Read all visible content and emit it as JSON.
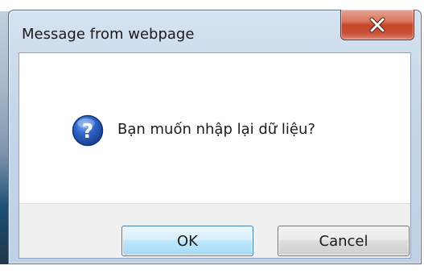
{
  "dialog": {
    "title": "Message from webpage",
    "message": "Bạn muốn nhập lại dữ liệu?",
    "icon": "question-icon",
    "close_icon": "close-icon",
    "buttons": {
      "ok_label": "OK",
      "cancel_label": "Cancel"
    }
  },
  "colors": {
    "close_button": "#c64629",
    "default_button_border": "#3c7fb1",
    "question_icon": "#2a5bb5"
  }
}
